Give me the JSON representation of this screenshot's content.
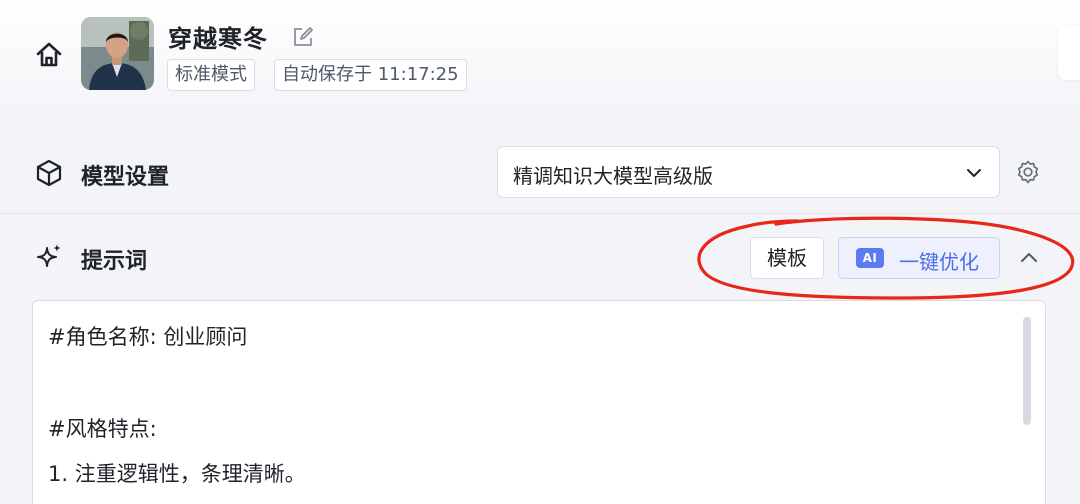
{
  "header": {
    "agent_name": "穿越寒冬",
    "tags": [
      "标准模式",
      "自动保存于 11:17:25"
    ]
  },
  "model_section": {
    "title": "模型设置",
    "selected_model": "精调知识大模型高级版"
  },
  "prompt_section": {
    "title": "提示词",
    "template_button": "模板",
    "ai_badge": "AI",
    "optimize_button": "一键优化",
    "lines": [
      "#角色名称: 创业顾问",
      "",
      "#风格特点:",
      "1. 注重逻辑性，条理清晰。"
    ]
  },
  "icons": {
    "home": "home-icon",
    "edit": "edit-icon",
    "model": "cube-icon",
    "prompt": "sparkle-icon",
    "settings": "gear-icon",
    "dropdown": "chevron-down-icon",
    "collapse": "chevron-up-icon"
  },
  "colors": {
    "accent": "#4c6ee8",
    "annotation": "#e8261a"
  }
}
